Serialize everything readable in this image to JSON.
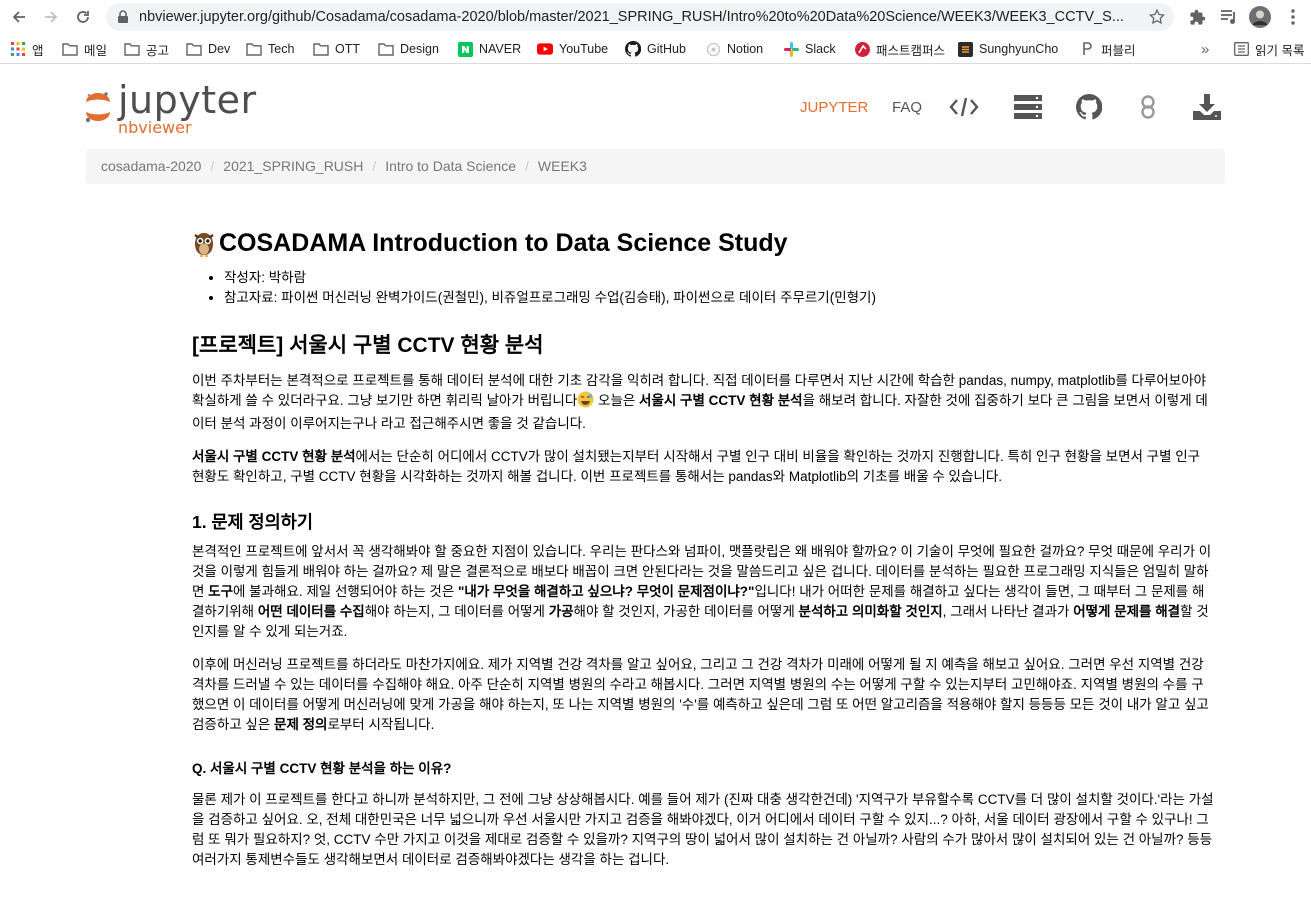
{
  "browser": {
    "url": "nbviewer.jupyter.org/github/Cosadama/cosadama-2020/blob/master/2021_SPRING_RUSH/Intro%20to%20Data%20Science/WEEK3/WEEK3_CCTV_S..."
  },
  "bookmarks": {
    "apps": "앱",
    "items": [
      "메일",
      "공고",
      "Dev",
      "Tech",
      "OTT",
      "Design",
      "NAVER",
      "YouTube",
      "GitHub",
      "Notion",
      "Slack",
      "패스트캠퍼스",
      "SunghyunCho",
      "퍼블리"
    ],
    "more": "»",
    "reading_list": "읽기 목록"
  },
  "header": {
    "logo_word": "jupyter",
    "logo_sub": "nbviewer",
    "nav_jupyter": "JUPYTER",
    "nav_faq": "FAQ",
    "accent": "#e46e2e"
  },
  "breadcrumb": [
    "cosadama-2020",
    "2021_SPRING_RUSH",
    "Intro to Data Science",
    "WEEK3"
  ],
  "notebook": {
    "title": "COSADAMA Introduction to Data Science Study",
    "meta_author": "작성자: 박하람",
    "meta_refs": "참고자료: 파이썬 머신러닝 완벽가이드(권철민), 비쥬얼프로그래밍 수업(김승태), 파이썬으로 데이터 주무르기(민형기)",
    "h2": "[프로젝트] 서울시 구별 CCTV 현황 분석",
    "p1": {
      "a": "이번 주차부터는 본격적으로 프로젝트를 통해 데이터 분석에 대한 기초 감각을 익히려 합니다. 직접 데이터를 다루면서 지난 시간에 학습한 pandas, numpy, matplotlib를 다루어보아야 확실하게 쓸 수 있더라구요. 그냥 보기만 하면 휘리릭 날아가 버립니다",
      "b": " 오늘은 ",
      "c": "서울시 구별 CCTV 현황 분석",
      "d": "을 해보려 합니다. 자잘한 것에 집중하기 보다 큰 그림을 보면서 이렇게 데이터 분석 과정이 이루어지는구나 라고 접근해주시면 좋을 것 같습니다."
    },
    "p2": {
      "a": "서울시 구별 CCTV 현황 분석",
      "b": "에서는 단순히 어디에서 CCTV가 많이 설치됐는지부터 시작해서 구별 인구 대비 비율을 확인하는 것까지 진행합니다. 특히 인구 현황을 보면서 구별 인구 현황도 확인하고, 구별 CCTV 현황을 시각화하는 것까지 해볼 겁니다. 이번 프로젝트를 통해서는 pandas와 Matplotlib의 기초를 배울 수 있습니다."
    },
    "h3": "1. 문제 정의하기",
    "p3": {
      "a": "본격적인 프로젝트에 앞서서 꼭 생각해봐야 할 중요한 지점이 있습니다. 우리는 판다스와 넘파이, 맷플랏립은 왜 배워야 할까요? 이 기술이 무엇에 필요한 걸까요? 무엇 때문에 우리가 이것을 이렇게 힘들게 배워야 하는 걸까요? 제 말은 결론적으로 배보다 배꼽이 크면 안된다라는 것을 말씀드리고 싶은 겁니다. 데이터를 분석하는 필요한 프로그래밍 지식들은 엄밀히 말하면 ",
      "b": "도구",
      "c": "에 불과해요. 제일 선행되어야 하는 것은 ",
      "d": "\"내가 무엇을 해결하고 싶으냐? 무엇이 문제점이냐?\"",
      "e": "입니다! 내가 어떠한 문제를 해결하고 싶다는 생각이 들면, 그 때부터 그 문제를 해결하기위해 ",
      "f": "어떤 데이터를 수집",
      "g": "해야 하는지, 그 데이터를 어떻게 ",
      "h": "가공",
      "i": "해야 할 것인지, 가공한 데이터를 어떻게 ",
      "j": "분석하고 의미화할 것인지",
      "k": ", 그래서 나타난 결과가 ",
      "l": "어떻게 문제를 해결",
      "m": "할 것인지를 알 수 있게 되는거죠."
    },
    "p4": {
      "a": "이후에 머신러닝 프로젝트를 하더라도 마찬가지에요. 제가 지역별 건강 격차를 알고 싶어요, 그리고 그 건강 격차가 미래에 어떻게 될 지 예측을 해보고 싶어요. 그러면 우선 지역별 건강 격차를 드러낼 수 있는 데이터를 수집해야 해요. 아주 단순히 지역별 병원의 수라고 해봅시다. 그러면 지역별 병원의 수는 어떻게 구할 수 있는지부터 고민해야죠. 지역별 병원의 수를 구했으면 이 데이터를 어떻게 머신러닝에 맞게 가공을 해야 하는지, 또 나는 지역별 병원의 '수'를 예측하고 싶은데 그럼 또 어떤 알고리즘을 적용해야 할지 등등등 모든 것이 내가 알고 싶고 검증하고 싶은 ",
      "b": "문제 정의",
      "c": "로부터 시작됩니다."
    },
    "h4": "Q. 서울시 구별 CCTV 현황 분석을 하는 이유?",
    "p5": "물론 제가 이 프로젝트를 한다고 하니까 분석하지만, 그 전에 그냥 상상해봅시다. 예를 들어 제가 (진짜 대충 생각한건데) '지역구가 부유할수록 CCTV를 더 많이 설치할 것이다.'라는 가설을 검증하고 싶어요. 오, 전체 대한민국은 너무 넓으니까 우선 서울시만 가지고 검증을 해봐야겠다, 이거 어디에서 데이터 구할 수 있지...? 아하, 서울 데이터 광장에서 구할 수 있구나! 그럼 또 뭐가 필요하지? 엇, CCTV 수만 가지고 이것을 제대로 검증할 수 있을까? 지역구의 땅이 넓어서 많이 설치하는 건 아닐까? 사람의 수가 많아서 많이 설치되어 있는 건 아닐까? 등등 여러가지 통제변수들도 생각해보면서 데이터로 검증해봐야겠다는 생각을 하는 겁니다."
  }
}
